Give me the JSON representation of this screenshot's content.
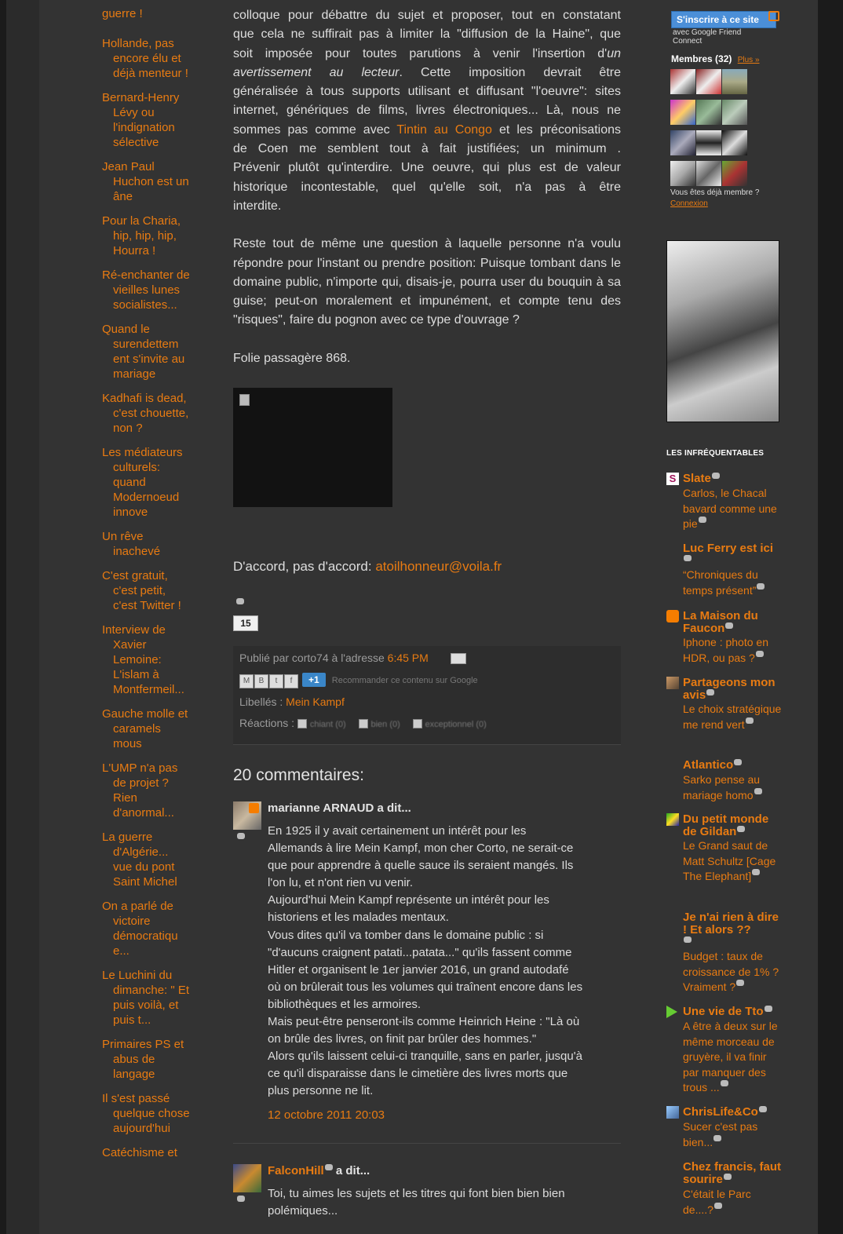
{
  "sidebar_left": {
    "posts": [
      "guerre !",
      "Hollande, pas encore élu et déjà menteur !",
      "Bernard-Henry Lévy ou l'indignation sélective",
      "Jean Paul Huchon est un âne",
      "Pour la Charia, hip, hip, hip, Hourra !",
      "Ré-enchanter de vieilles lunes socialistes...",
      "Quand le surendettem ent s'invite au mariage",
      "Kadhafi is dead, c'est chouette, non ?",
      "Les médiateurs culturels: quand Modernoeud innove",
      "Un rêve inachevé",
      "C'est gratuit, c'est petit, c'est Twitter !",
      "Interview de Xavier Lemoine: L'islam à Montfermeil...",
      "Gauche molle et caramels mous",
      "L'UMP n'a pas de projet ? Rien d'anormal...",
      "La guerre d'Algérie... vue du pont Saint Michel",
      "On a parlé de victoire démocratiqu e...",
      "Le Luchini du dimanche: \" Et puis voilà, et puis t...",
      "Primaires PS et abus de langage",
      "Il s'est passé quelque chose aujourd'hui",
      "Catéchisme et"
    ]
  },
  "article": {
    "para1_lines": [
      "colloque pour débattre du sujet et proposer, tout en constatant",
      "que cela ne suffirait pas à limiter la \"diffusion de la Haine\", que",
      "soit imposée pour toutes parutions à venir l'insertion d'",
      "un avertissement au lecteur",
      ". Cette imposition devrait être",
      "généralisée à tous supports utilisant et diffusant \"l'oeuvre\": sites",
      "internet, génériques de films, livres électroniques... Là, nous ne",
      "sommes pas comme avec ",
      "Tintin au Congo",
      " et les préconisations",
      "de Coen me semblent tout à fait justifiées; un minimum .",
      "Prévenir plutôt qu'interdire. Une oeuvre, qui plus est de valeur",
      "historique incontestable, quel qu'elle soit, n'a pas à être",
      "interdite."
    ],
    "para2": "Reste tout de même une question à laquelle personne n'a voulu répondre pour l'instant ou  prendre position:  Puisque tombant dans le domaine public, n'importe qui, disais-je, pourra user du bouquin à sa guise; peut-on moralement et impunément, et compte tenu des \"risques\", faire du pognon avec ce type d'ouvrage ?",
    "folie": "Folie passagère 868.",
    "agree_label": "D'accord, pas d'accord: ",
    "agree_email": "atoilhonneur@voila.fr",
    "count_badge": "15"
  },
  "post_footer": {
    "published_by": "Publié par corto74 à l'adresse ",
    "time": "6:45 PM",
    "share_icons": [
      "M",
      "B",
      "t",
      "f"
    ],
    "plus_one": "+1",
    "recommend": "Recommander ce contenu sur Google",
    "labels_prefix": "Libellés : ",
    "label": "Mein Kampf",
    "reactions_prefix": "Réactions : ",
    "reactions": [
      "chiant (0)",
      "bien (0)",
      "exceptionnel (0)"
    ]
  },
  "comments": {
    "title": "20 commentaires:",
    "items": [
      {
        "author": "marianne ARNAUD",
        "said": " a dit...",
        "lines": [
          "En 1925 il y avait certainement un intérêt pour les",
          "Allemands à lire Mein Kampf, mon cher Corto, ne serait-ce",
          "que pour apprendre à quelle sauce ils seraient mangés. Ils",
          "l'on lu, et n'ont rien vu venir.",
          "Aujourd'hui Mein Kampf représente un intérêt pour les",
          "historiens et les malades mentaux.",
          "Vous dites qu'il va tomber dans le domaine public : si",
          "\"d'aucuns craignent patati...patata...\" qu'ils fassent comme",
          "Hitler et organisent le 1er janvier 2016, un grand autodafé",
          "où on brûlerait tous les volumes qui traînent encore dans les",
          "bibliothèques et les armoires.",
          "Mais peut-être penseront-ils comme Heinrich Heine : \"Là où",
          "on brûle des livres, on finit par brûler des hommes.\"",
          "Alors qu'ils laissent celui-ci tranquille, sans en parler, jusqu'à",
          "ce qu'il disparaisse dans le cimetière des livres morts que",
          "plus personne ne lit."
        ],
        "date": "12 octobre 2011 20:03"
      },
      {
        "author": "FalconHill",
        "said": " a dit...",
        "lines": [
          "Toi, tu aimes les sujets et les titres qui font bien bien bien",
          "polémiques..."
        ]
      }
    ]
  },
  "sidebar_right": {
    "gfc_button": "S'inscrire à ce site",
    "gfc_sub": "avec Google Friend Connect",
    "members_title": "Membres (32)",
    "more": "Plus »",
    "already_member": "Vous êtes déjà membre ?",
    "login": "Connexion",
    "blogroll_title": "LES INFRÉQUENTABLES",
    "blogs": [
      {
        "name": "Slate",
        "post": "Carlos, le Chacal bavard comme une pie"
      },
      {
        "name": "Luc Ferry est ici",
        "post": "“Chroniques du temps présent”"
      },
      {
        "name": "La Maison du Faucon",
        "post": "Iphone : photo en HDR, ou pas ?"
      },
      {
        "name": "Partageons mon avis",
        "post": "Le choix stratégique me rend vert"
      },
      {
        "name": "Atlantico",
        "post": "Sarko pense au mariage homo"
      },
      {
        "name": "Du petit monde de Gildan",
        "post": "Le Grand saut de Matt Schultz [Cage The Elephant]"
      },
      {
        "name": "Je n'ai rien à dire ! Et alors ??",
        "post": "Budget : taux de croissance de 1% ? Vraiment ?"
      },
      {
        "name": "Une vie de Tto",
        "post": "A être à deux sur le même morceau de gruyère, il va finir par manquer des trous ..."
      },
      {
        "name": "ChrisLife&Co",
        "post": "Sucer c'est pas bien..."
      },
      {
        "name": "Chez francis, faut sourire",
        "post": "C'était le Parc de....?"
      }
    ]
  },
  "colors": {
    "link": "#e87b12",
    "background": "#333333",
    "text": "#dedede"
  }
}
